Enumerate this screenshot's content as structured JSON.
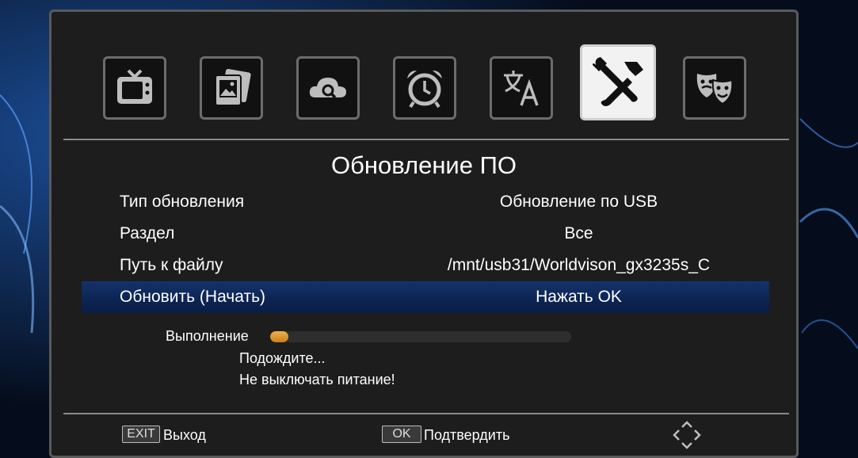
{
  "menu": {
    "tabs": [
      {
        "icon": "tv-icon"
      },
      {
        "icon": "media-icon"
      },
      {
        "icon": "cloud-search-icon"
      },
      {
        "icon": "alarm-clock-icon"
      },
      {
        "icon": "language-icon"
      },
      {
        "icon": "tools-icon",
        "selected": true
      },
      {
        "icon": "theater-icon"
      }
    ]
  },
  "page": {
    "title": "Обновление ПО"
  },
  "settings": [
    {
      "label": "Тип обновления",
      "value": "Обновление по USB"
    },
    {
      "label": "Раздел",
      "value": "Все"
    },
    {
      "label": "Путь к файлу",
      "value": "/mnt/usb31/Worldvison_gx3235s_C"
    },
    {
      "label": "Обновить (Начать)",
      "value": "Нажать OK",
      "selected": true
    }
  ],
  "progress": {
    "label": "Выполнение",
    "percent": 6
  },
  "messages": {
    "wait": "Подождите...",
    "warning": "Не выключать питание!"
  },
  "footer": {
    "exit_key": "EXIT",
    "exit_label": "Выход",
    "ok_key": "OK",
    "ok_label": "Подтвердить",
    "nav_icon": "navigation-arrows-icon"
  },
  "colors": {
    "selection": "#0c2452",
    "progress": "#d99030",
    "panel": "#1d1d1d"
  }
}
